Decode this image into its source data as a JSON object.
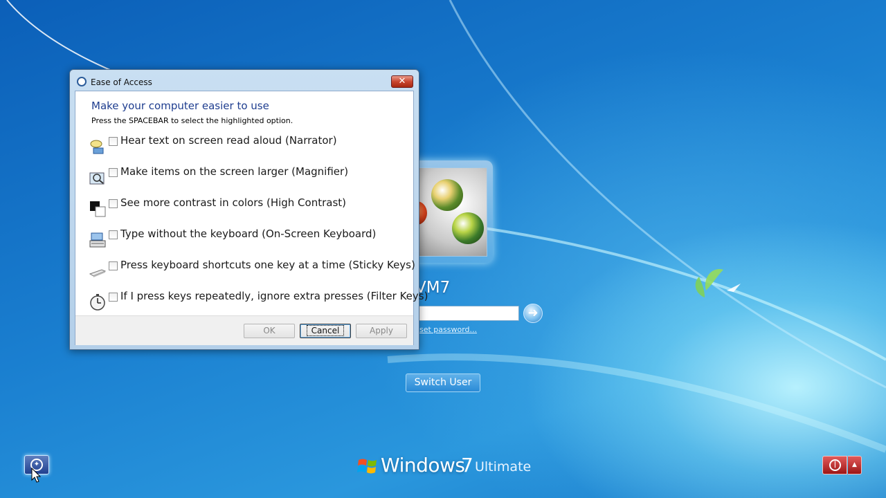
{
  "logon": {
    "username": "VM7",
    "password_value": "",
    "reset_link": "set password...",
    "switch_user": "Switch User",
    "go_arrow": "➜"
  },
  "branding": {
    "name": "Windows",
    "version": "7",
    "edition": "Ultimate"
  },
  "taskbar": {
    "ease_icon": "ease-of-access-icon",
    "power_icon": "power-icon",
    "power_arrow": "▲"
  },
  "dialog": {
    "title": "Ease of Access",
    "close_label": "✕",
    "heading": "Make your computer easier to use",
    "instructions": "Press the SPACEBAR to select the highlighted option.",
    "options": [
      {
        "label": "Hear text on screen read aloud (Narrator)",
        "icon": "narrator-icon",
        "checked": false
      },
      {
        "label": "Make items on the screen larger (Magnifier)",
        "icon": "magnifier-icon",
        "checked": false
      },
      {
        "label": "See more contrast in colors (High Contrast)",
        "icon": "high-contrast-icon",
        "checked": false
      },
      {
        "label": "Type without the keyboard (On-Screen Keyboard)",
        "icon": "on-screen-keyboard-icon",
        "checked": false
      },
      {
        "label": "Press keyboard shortcuts one key at a time (Sticky Keys)",
        "icon": "sticky-keys-icon",
        "checked": false
      },
      {
        "label": "If I press keys repeatedly, ignore extra presses (Filter Keys)",
        "icon": "filter-keys-icon",
        "checked": false
      }
    ],
    "buttons": {
      "ok": "OK",
      "cancel": "Cancel",
      "apply": "Apply"
    }
  },
  "colors": {
    "heading": "#1e3d8f",
    "power": "#c2272d",
    "desktop": "#1a7fd0"
  }
}
